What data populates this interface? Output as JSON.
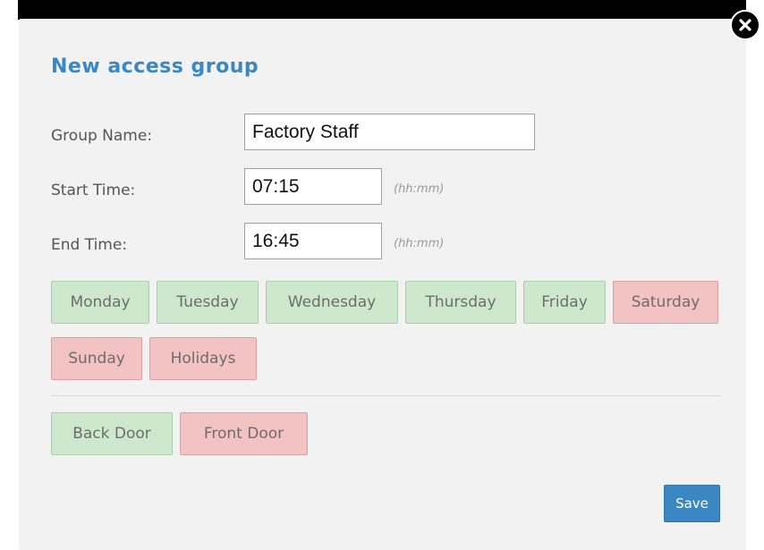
{
  "dialog": {
    "title": "New access group",
    "close_icon": "close-icon"
  },
  "form": {
    "group_name_label": "Group Name:",
    "group_name_value": "Factory Staff",
    "start_time_label": "Start Time:",
    "start_time_value": "07:15",
    "start_time_hint": "(hh:mm)",
    "end_time_label": "End Time:",
    "end_time_value": "16:45",
    "end_time_hint": "(hh:mm)"
  },
  "days": [
    {
      "label": "Monday",
      "enabled": true
    },
    {
      "label": "Tuesday",
      "enabled": true
    },
    {
      "label": "Wednesday",
      "enabled": true
    },
    {
      "label": "Thursday",
      "enabled": true
    },
    {
      "label": "Friday",
      "enabled": true
    },
    {
      "label": "Saturday",
      "enabled": false
    },
    {
      "label": "Sunday",
      "enabled": false
    },
    {
      "label": "Holidays",
      "enabled": false
    }
  ],
  "doors": [
    {
      "label": "Back Door",
      "enabled": true
    },
    {
      "label": "Front Door",
      "enabled": false
    }
  ],
  "actions": {
    "save_label": "Save"
  },
  "colors": {
    "accent": "#3a87c4",
    "enabled_tag": "#cde8cd",
    "disabled_tag": "#f3c3c3"
  }
}
